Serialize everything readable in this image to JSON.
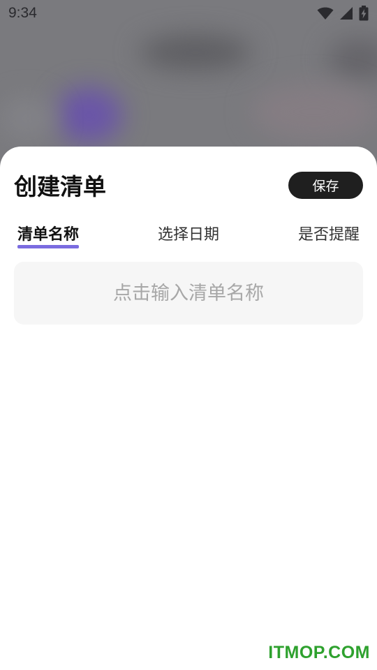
{
  "status_bar": {
    "time": "9:34",
    "icons": [
      "wifi-icon",
      "cellular-signal-icon",
      "battery-charging-icon"
    ]
  },
  "sheet": {
    "title": "创建清单",
    "save_label": "保存",
    "tabs": [
      {
        "label": "清单名称",
        "active": true
      },
      {
        "label": "选择日期",
        "active": false
      },
      {
        "label": "是否提醒",
        "active": false
      }
    ],
    "name_input": {
      "placeholder": "点击输入清单名称",
      "value": ""
    }
  },
  "watermark": "ITMOP.COM",
  "colors": {
    "accent_underline": "#7b6ce0",
    "save_button_bg": "#1f1f1f",
    "input_bg": "#f6f6f6",
    "watermark": "#2ea12e"
  }
}
